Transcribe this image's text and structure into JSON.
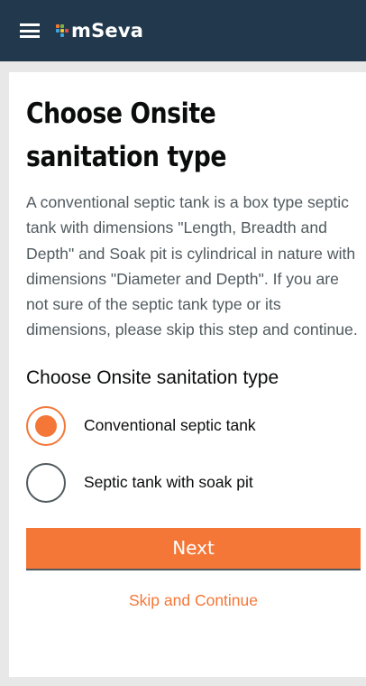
{
  "header": {
    "menu_icon": "hamburger-menu-icon",
    "logo_text": "mSeva",
    "background": "#22394d"
  },
  "page": {
    "title": "Choose Onsite sanitation type",
    "description": "A conventional septic tank is a box type septic tank with dimensions \"Length, Breadth and Depth\" and Soak pit is cylindrical in nature with dimensions \"Diameter and Depth\". If you are not sure of the septic tank type or its dimensions, please skip this step and continue.",
    "field_label": "Choose Onsite sanitation type",
    "options": [
      {
        "label": "Conventional septic tank",
        "selected": true
      },
      {
        "label": "Septic tank with soak pit",
        "selected": false
      }
    ],
    "next_label": "Next",
    "skip_label": "Skip and Continue"
  },
  "colors": {
    "accent": "#f47738",
    "header_bg": "#22394d",
    "text_primary": "#0b0c0c",
    "text_secondary": "#505a5f"
  }
}
